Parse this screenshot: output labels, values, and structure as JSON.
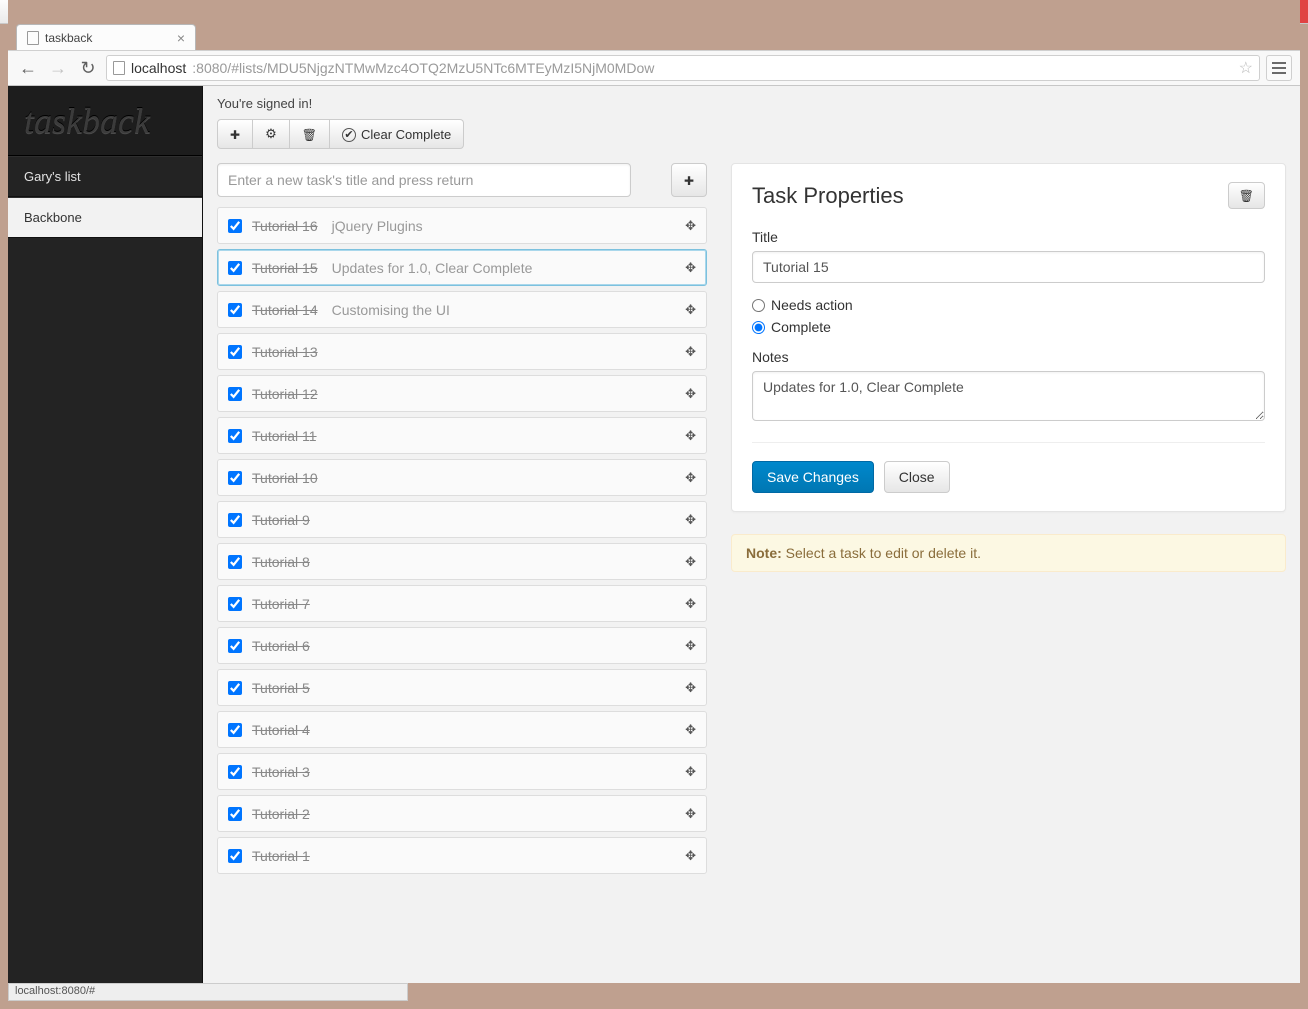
{
  "window": {
    "min": "-",
    "max": "▢",
    "close": "✕"
  },
  "browser": {
    "tab_title": "taskback",
    "url_host": "localhost",
    "url_path": ":8080/#lists/MDU5NjgzNTMwMzc4OTQ2MzU5NTc6MTEyMzI5NjM0MDow",
    "status": "localhost:8080/#"
  },
  "sidebar": {
    "logo": "taskback",
    "items": [
      {
        "label": "Gary's list",
        "active": false
      },
      {
        "label": "Backbone",
        "active": true
      }
    ]
  },
  "header": {
    "signed_in": "You're signed in!",
    "clear_complete": "Clear Complete",
    "new_task_placeholder": "Enter a new task's title and press return"
  },
  "tasks": [
    {
      "title": "Tutorial 16",
      "subtitle": "jQuery Plugins",
      "checked": true,
      "selected": false
    },
    {
      "title": "Tutorial 15",
      "subtitle": "Updates for 1.0, Clear Complete",
      "checked": true,
      "selected": true
    },
    {
      "title": "Tutorial 14",
      "subtitle": "Customising the UI",
      "checked": true,
      "selected": false
    },
    {
      "title": "Tutorial 13",
      "subtitle": "",
      "checked": true,
      "selected": false
    },
    {
      "title": "Tutorial 12",
      "subtitle": "",
      "checked": true,
      "selected": false
    },
    {
      "title": "Tutorial 11",
      "subtitle": "",
      "checked": true,
      "selected": false
    },
    {
      "title": "Tutorial 10",
      "subtitle": "",
      "checked": true,
      "selected": false
    },
    {
      "title": "Tutorial 9",
      "subtitle": "",
      "checked": true,
      "selected": false
    },
    {
      "title": "Tutorial 8",
      "subtitle": "",
      "checked": true,
      "selected": false
    },
    {
      "title": "Tutorial 7",
      "subtitle": "",
      "checked": true,
      "selected": false
    },
    {
      "title": "Tutorial 6",
      "subtitle": "",
      "checked": true,
      "selected": false
    },
    {
      "title": "Tutorial 5",
      "subtitle": "",
      "checked": true,
      "selected": false
    },
    {
      "title": "Tutorial 4",
      "subtitle": "",
      "checked": true,
      "selected": false
    },
    {
      "title": "Tutorial 3",
      "subtitle": "",
      "checked": true,
      "selected": false
    },
    {
      "title": "Tutorial 2",
      "subtitle": "",
      "checked": true,
      "selected": false
    },
    {
      "title": "Tutorial 1",
      "subtitle": "",
      "checked": true,
      "selected": false
    }
  ],
  "props": {
    "heading": "Task Properties",
    "title_label": "Title",
    "title_value": "Tutorial 15",
    "status_needs": "Needs action",
    "status_complete": "Complete",
    "status_selected": "complete",
    "notes_label": "Notes",
    "notes_value": "Updates for 1.0, Clear Complete",
    "save_label": "Save Changes",
    "close_label": "Close"
  },
  "note": {
    "prefix": "Note:",
    "body": " Select a task to edit or delete it."
  }
}
